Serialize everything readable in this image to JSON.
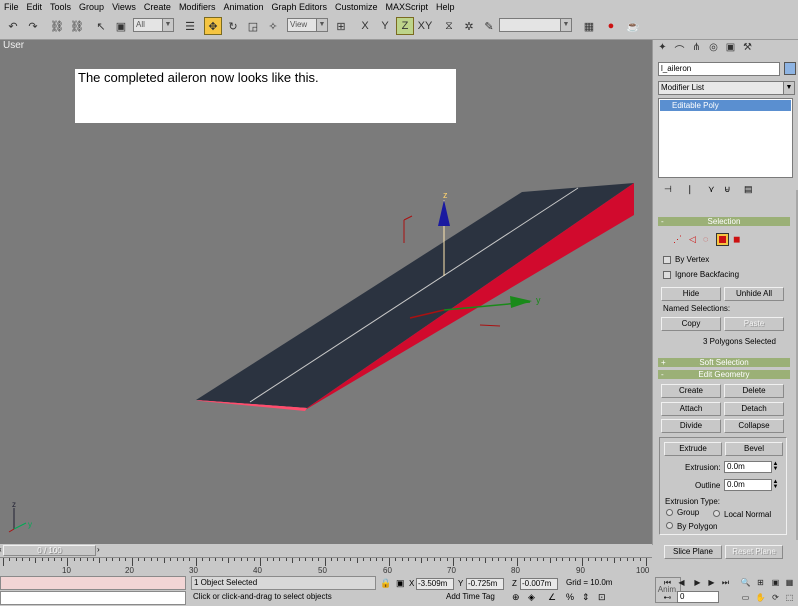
{
  "menu": [
    "File",
    "Edit",
    "Tools",
    "Group",
    "Views",
    "Create",
    "Modifiers",
    "Animation",
    "Graph Editors",
    "Customize",
    "MAXScript",
    "Help"
  ],
  "toolbar": {
    "selection_filter": "All",
    "ref_coord": "View",
    "named_sel": ""
  },
  "viewport": {
    "label": "User",
    "caption": "The completed aileron now looks like this.",
    "gizmo_z": "z",
    "gizmo_y": "y",
    "axis_z": "z",
    "axis_y": "y"
  },
  "command_panel": {
    "object_name": "l_aileron",
    "modifier_list": "Modifier List",
    "stack_item": "Editable Poly",
    "selection": {
      "title": "Selection",
      "by_vertex": "By Vertex",
      "ignore_backfacing": "Ignore Backfacing",
      "hide": "Hide",
      "unhide_all": "Unhide All",
      "named_selections": "Named Selections:",
      "copy": "Copy",
      "paste": "Paste",
      "status": "3 Polygons Selected"
    },
    "soft_selection": "Soft Selection",
    "edit_geometry": {
      "title": "Edit Geometry",
      "create": "Create",
      "delete": "Delete",
      "attach": "Attach",
      "detach": "Detach",
      "divide": "Divide",
      "collapse": "Collapse",
      "extrude": "Extrude",
      "bevel": "Bevel",
      "extrusion_label": "Extrusion:",
      "extrusion_value": "0.0m",
      "outline_label": "Outline",
      "outline_value": "0.0m",
      "extrusion_type": "Extrusion Type:",
      "group": "Group",
      "local_normal": "Local Normal",
      "by_polygon": "By Polygon",
      "slice_plane": "Slice Plane",
      "reset_plane": "Reset Plane"
    }
  },
  "timeslider": {
    "frame": "0 / 100",
    "ticks": [
      "10",
      "20",
      "30",
      "40",
      "50",
      "60",
      "70",
      "80",
      "90",
      "100"
    ]
  },
  "status": {
    "objects_selected": "1 Object Selected",
    "prompt": "Click or click-and-drag to select objects",
    "x_label": "X",
    "x": "-3.509m",
    "y_label": "Y",
    "y": "-0.725m",
    "z_label": "Z",
    "z": "-0.007m",
    "grid": "Grid = 10.0m",
    "add_time_tag": "Add Time Tag",
    "anim": "Anim.",
    "current_frame": "0"
  },
  "colors": {
    "viewport_bg": "#7b7b7b",
    "object_top": "#2b3340",
    "object_side": "#d10a2d",
    "object_end": "#ff4d6d",
    "rollout": "#9bb077",
    "stack_selected": "#5a8fd0"
  }
}
